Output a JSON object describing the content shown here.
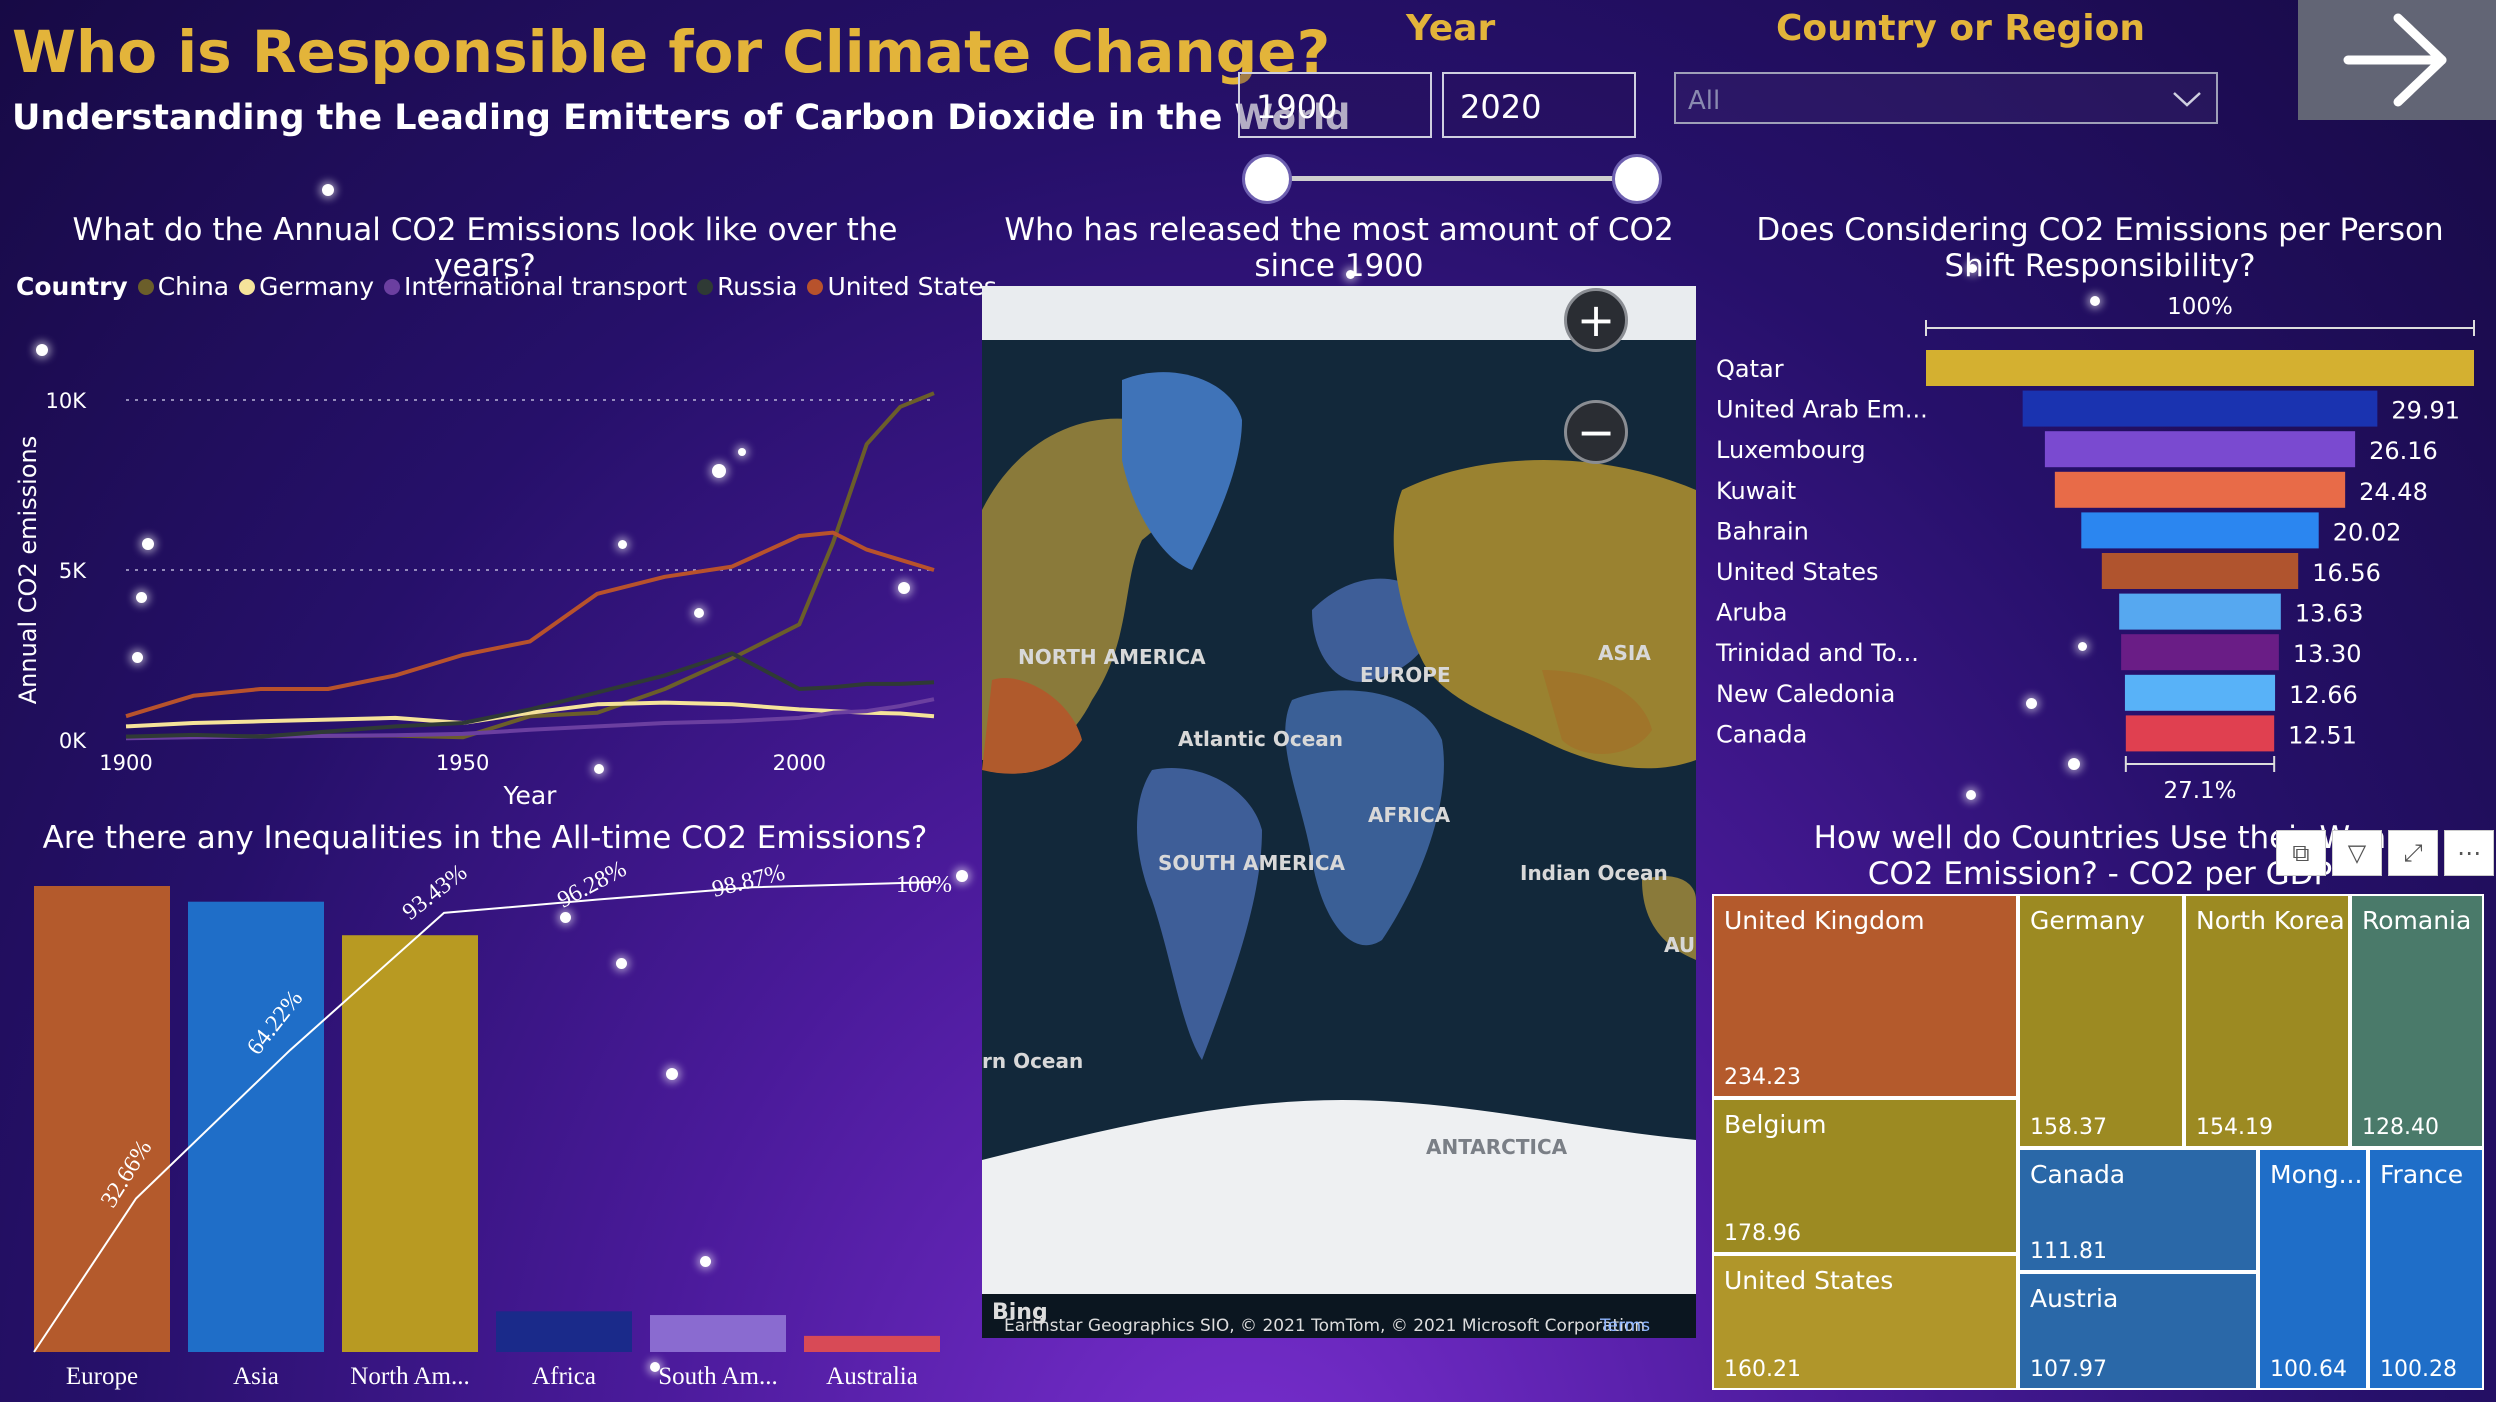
{
  "header": {
    "title": "Who is Responsible for Climate Change?",
    "subtitle": "Understanding the Leading Emitters of Carbon Dioxide in the World"
  },
  "slicers": {
    "year_label": "Year",
    "year_from": "1900",
    "year_to": "2020",
    "country_label": "Country or Region",
    "country_value": "All"
  },
  "colors": {
    "gold": "#e3b43a",
    "china": "#6b5e2a",
    "germany": "#f5e39a",
    "international_transport": "#6b3fa0",
    "russia": "#2f3a35",
    "united_states": "#b8522c"
  },
  "icons": {
    "next": "arrow-right-icon",
    "zoom_in": "plus-icon",
    "zoom_out": "minus-icon",
    "dropdown": "chevron-down-icon"
  },
  "line_chart": {
    "title": "What do the Annual CO2 Emissions look like over the years?",
    "legend_title": "Country",
    "series_names": [
      "China",
      "Germany",
      "International transport",
      "Russia",
      "United States"
    ],
    "ylabel": "Annual CO2 emissions",
    "xlabel": "Year",
    "yticks": [
      "10K",
      "5K",
      "0K"
    ],
    "xticks": [
      "1900",
      "1950",
      "2000"
    ]
  },
  "map_chart": {
    "title": "Who has released the most amount of CO2 since 1900",
    "labels": [
      "NORTH AMERICA",
      "EUROPE",
      "ASIA",
      "Atlantic Ocean",
      "AFRICA",
      "SOUTH AMERICA",
      "Indian Ocean",
      "ANTARCTICA",
      "rn Ocean",
      "AU"
    ],
    "bing": "Bing",
    "attribution": "Earthstar Geographics SIO, © 2021 TomTom, © 2021 Microsoft Corporation",
    "terms": "Terms"
  },
  "funnel_chart": {
    "title": "Does Considering CO2 Emissions per Person Shift Responsibility?",
    "top_label": "100%",
    "bottom_label": "27.1%"
  },
  "pareto_chart": {
    "title": "Are there any Inequalities in the All-time CO2 Emissions?"
  },
  "treemap": {
    "title_line1": "How well do Countries Use their Wea",
    "title_line2": "CO2 Emission? - CO2 per GDP",
    "cells": [
      {
        "name": "United Kingdom",
        "value": "234.23"
      },
      {
        "name": "Germany",
        "value": "158.37"
      },
      {
        "name": "North Korea",
        "value": "154.19"
      },
      {
        "name": "Romania",
        "value": "128.40"
      },
      {
        "name": "Belgium",
        "value": "178.96"
      },
      {
        "name": "Canada",
        "value": "111.81"
      },
      {
        "name": "Mong...",
        "value": "100.64"
      },
      {
        "name": "France",
        "value": "100.28"
      },
      {
        "name": "United States",
        "value": "160.21"
      },
      {
        "name": "Austria",
        "value": "107.97"
      }
    ]
  },
  "chart_data": [
    {
      "type": "line",
      "title": "What do the Annual CO2 Emissions look like over the years?",
      "xlabel": "Year",
      "ylabel": "Annual CO2 emissions",
      "ylim": [
        0,
        10000
      ],
      "xlim": [
        1900,
        2020
      ],
      "legend": "top",
      "grid": true,
      "x": [
        1900,
        1910,
        1920,
        1930,
        1940,
        1950,
        1960,
        1970,
        1980,
        1990,
        2000,
        2005,
        2010,
        2015,
        2020
      ],
      "series": [
        {
          "name": "China",
          "values": [
            90,
            100,
            110,
            120,
            130,
            80,
            700,
            800,
            1500,
            2400,
            3400,
            5800,
            8700,
            9800,
            10200
          ]
        },
        {
          "name": "Germany",
          "values": [
            400,
            500,
            550,
            600,
            650,
            500,
            800,
            1050,
            1100,
            1050,
            900,
            850,
            800,
            780,
            700
          ]
        },
        {
          "name": "International transport",
          "values": [
            50,
            80,
            100,
            120,
            140,
            180,
            300,
            400,
            500,
            550,
            650,
            800,
            850,
            1000,
            1200
          ]
        },
        {
          "name": "Russia",
          "values": [
            100,
            150,
            100,
            250,
            400,
            500,
            900,
            1400,
            1900,
            2550,
            1500,
            1550,
            1650,
            1650,
            1700
          ]
        },
        {
          "name": "United States",
          "values": [
            700,
            1300,
            1500,
            1500,
            1900,
            2500,
            2900,
            4300,
            4800,
            5100,
            6000,
            6100,
            5600,
            5300,
            5000
          ]
        }
      ]
    },
    {
      "type": "bar",
      "title": "Who has released the most amount of CO2 since 1900",
      "note": "map (choropleth)"
    },
    {
      "type": "bar",
      "title": "Does Considering CO2 Emissions per Person Shift Responsibility?",
      "categories": [
        "Qatar",
        "United Arab Em...",
        "Luxembourg",
        "Kuwait",
        "Bahrain",
        "United States",
        "Aruba",
        "Trinidad and To...",
        "New Caledonia",
        "Canada"
      ],
      "values": [
        46.21,
        29.91,
        26.16,
        24.48,
        20.02,
        16.56,
        13.63,
        13.3,
        12.66,
        12.51
      ],
      "labels": [
        "",
        "29.91",
        "26.16",
        "24.48",
        "20.02",
        "16.56",
        "13.63",
        "13.30",
        "12.66",
        "12.51"
      ],
      "colors": [
        "#d4b030",
        "#1a33b0",
        "#7a4ad0",
        "#e86b48",
        "#2b86f0",
        "#b0542e",
        "#56a8f0",
        "#6a1d86",
        "#58b2f8",
        "#e04050"
      ]
    },
    {
      "type": "bar",
      "title": "Are there any Inequalities in the All-time CO2 Emissions?",
      "categories": [
        "Europe",
        "Asia",
        "North Am...",
        "Africa",
        "South Am...",
        "Australia"
      ],
      "values": [
        32.66,
        31.56,
        29.21,
        2.85,
        2.59,
        1.13
      ],
      "cumulative": [
        "32.66%",
        "64.22%",
        "93.43%",
        "96.28%",
        "98.87%",
        "100%"
      ],
      "colors": [
        "#b45a2c",
        "#1f6ec8",
        "#b89a22",
        "#1a2a8a",
        "#8a6bd0",
        "#d84a56"
      ]
    },
    {
      "type": "table",
      "title": "How well do Countries Use their Wealth for CO2 Emission? - CO2 per GDP",
      "categories": [
        "United Kingdom",
        "Germany",
        "North Korea",
        "Romania",
        "Belgium",
        "Canada",
        "Mong...",
        "France",
        "United States",
        "Austria"
      ],
      "values": [
        234.23,
        158.37,
        154.19,
        128.4,
        178.96,
        111.81,
        100.64,
        100.28,
        160.21,
        107.97
      ]
    }
  ]
}
